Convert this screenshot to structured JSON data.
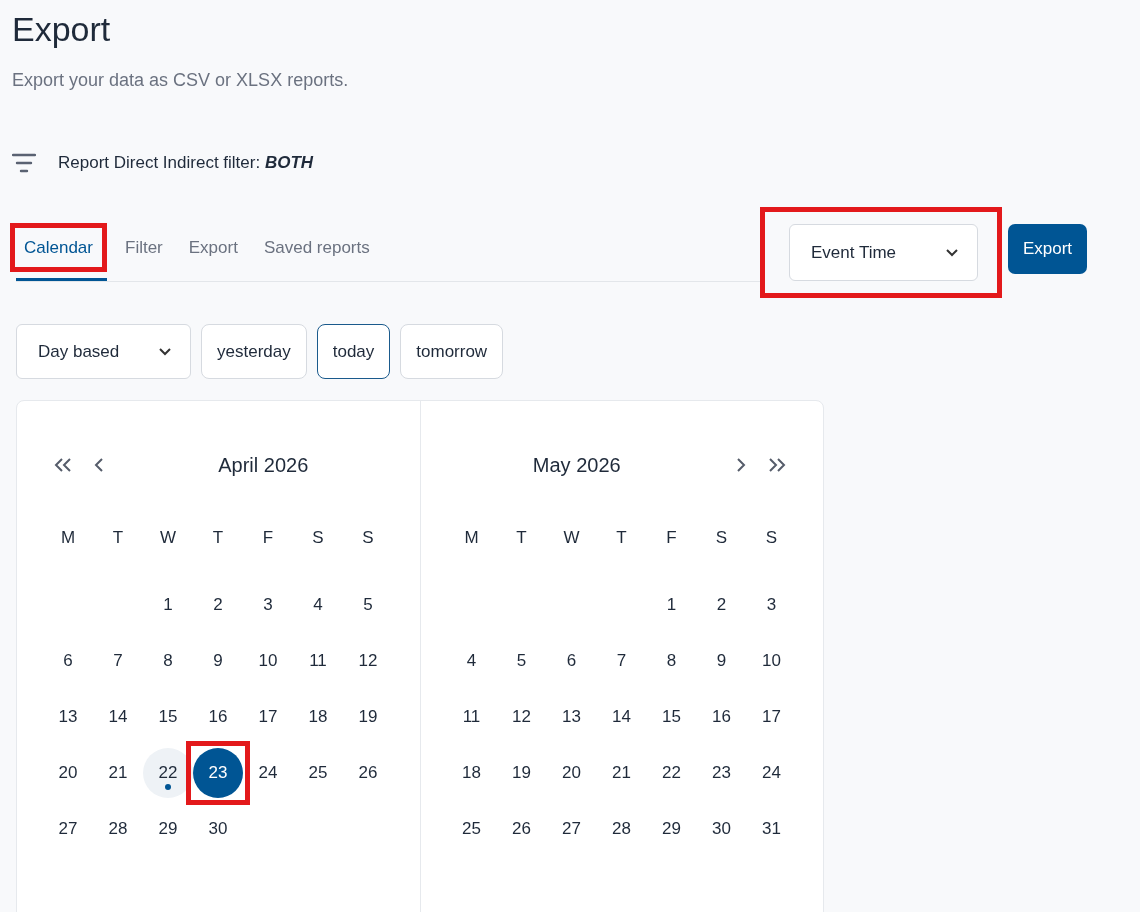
{
  "page": {
    "title": "Export",
    "subtitle": "Export your data as CSV or XLSX reports."
  },
  "filter_summary": {
    "label": "Report Direct Indirect filter:",
    "value": "BOTH"
  },
  "tabs": [
    {
      "label": "Calendar",
      "selected": true,
      "annotated": true
    },
    {
      "label": "Filter",
      "selected": false,
      "annotated": false
    },
    {
      "label": "Export",
      "selected": false,
      "annotated": false
    },
    {
      "label": "Saved reports",
      "selected": false,
      "annotated": false
    }
  ],
  "time_dropdown": {
    "value": "Event Time",
    "annotated": true
  },
  "export_button": {
    "label": "Export"
  },
  "range_dropdown": {
    "value": "Day based"
  },
  "quick_buttons": [
    {
      "label": "yesterday",
      "selected": false
    },
    {
      "label": "today",
      "selected": true
    },
    {
      "label": "tomorrow",
      "selected": false
    }
  ],
  "calendar": {
    "months": [
      {
        "title": "April 2026",
        "prev_buttons": true,
        "next_buttons": false,
        "weekdays": [
          "M",
          "T",
          "W",
          "T",
          "F",
          "S",
          "S"
        ],
        "days": [
          {
            "kind": "blank"
          },
          {
            "kind": "blank"
          },
          {
            "kind": "day",
            "label": "1",
            "selected": false,
            "today": false,
            "annotated": false
          },
          {
            "kind": "day",
            "label": "2",
            "selected": false,
            "today": false,
            "annotated": false
          },
          {
            "kind": "day",
            "label": "3",
            "selected": false,
            "today": false,
            "annotated": false
          },
          {
            "kind": "day",
            "label": "4",
            "selected": false,
            "today": false,
            "annotated": false
          },
          {
            "kind": "day",
            "label": "5",
            "selected": false,
            "today": false,
            "annotated": false
          },
          {
            "kind": "day",
            "label": "6",
            "selected": false,
            "today": false,
            "annotated": false
          },
          {
            "kind": "day",
            "label": "7",
            "selected": false,
            "today": false,
            "annotated": false
          },
          {
            "kind": "day",
            "label": "8",
            "selected": false,
            "today": false,
            "annotated": false
          },
          {
            "kind": "day",
            "label": "9",
            "selected": false,
            "today": false,
            "annotated": false
          },
          {
            "kind": "day",
            "label": "10",
            "selected": false,
            "today": false,
            "annotated": false
          },
          {
            "kind": "day",
            "label": "11",
            "selected": false,
            "today": false,
            "annotated": false
          },
          {
            "kind": "day",
            "label": "12",
            "selected": false,
            "today": false,
            "annotated": false
          },
          {
            "kind": "day",
            "label": "13",
            "selected": false,
            "today": false,
            "annotated": false
          },
          {
            "kind": "day",
            "label": "14",
            "selected": false,
            "today": false,
            "annotated": false
          },
          {
            "kind": "day",
            "label": "15",
            "selected": false,
            "today": false,
            "annotated": false
          },
          {
            "kind": "day",
            "label": "16",
            "selected": false,
            "today": false,
            "annotated": false
          },
          {
            "kind": "day",
            "label": "17",
            "selected": false,
            "today": false,
            "annotated": false
          },
          {
            "kind": "day",
            "label": "18",
            "selected": false,
            "today": false,
            "annotated": false
          },
          {
            "kind": "day",
            "label": "19",
            "selected": false,
            "today": false,
            "annotated": false
          },
          {
            "kind": "day",
            "label": "20",
            "selected": false,
            "today": false,
            "annotated": false
          },
          {
            "kind": "day",
            "label": "21",
            "selected": false,
            "today": false,
            "annotated": false
          },
          {
            "kind": "day",
            "label": "22",
            "selected": false,
            "today": true,
            "annotated": false
          },
          {
            "kind": "day",
            "label": "23",
            "selected": true,
            "today": false,
            "annotated": true
          },
          {
            "kind": "day",
            "label": "24",
            "selected": false,
            "today": false,
            "annotated": false
          },
          {
            "kind": "day",
            "label": "25",
            "selected": false,
            "today": false,
            "annotated": false
          },
          {
            "kind": "day",
            "label": "26",
            "selected": false,
            "today": false,
            "annotated": false
          },
          {
            "kind": "day",
            "label": "27",
            "selected": false,
            "today": false,
            "annotated": false
          },
          {
            "kind": "day",
            "label": "28",
            "selected": false,
            "today": false,
            "annotated": false
          },
          {
            "kind": "day",
            "label": "29",
            "selected": false,
            "today": false,
            "annotated": false
          },
          {
            "kind": "day",
            "label": "30",
            "selected": false,
            "today": false,
            "annotated": false
          }
        ]
      },
      {
        "title": "May 2026",
        "prev_buttons": false,
        "next_buttons": true,
        "weekdays": [
          "M",
          "T",
          "W",
          "T",
          "F",
          "S",
          "S"
        ],
        "days": [
          {
            "kind": "blank"
          },
          {
            "kind": "blank"
          },
          {
            "kind": "blank"
          },
          {
            "kind": "blank"
          },
          {
            "kind": "day",
            "label": "1",
            "selected": false,
            "today": false,
            "annotated": false
          },
          {
            "kind": "day",
            "label": "2",
            "selected": false,
            "today": false,
            "annotated": false
          },
          {
            "kind": "day",
            "label": "3",
            "selected": false,
            "today": false,
            "annotated": false
          },
          {
            "kind": "day",
            "label": "4",
            "selected": false,
            "today": false,
            "annotated": false
          },
          {
            "kind": "day",
            "label": "5",
            "selected": false,
            "today": false,
            "annotated": false
          },
          {
            "kind": "day",
            "label": "6",
            "selected": false,
            "today": false,
            "annotated": false
          },
          {
            "kind": "day",
            "label": "7",
            "selected": false,
            "today": false,
            "annotated": false
          },
          {
            "kind": "day",
            "label": "8",
            "selected": false,
            "today": false,
            "annotated": false
          },
          {
            "kind": "day",
            "label": "9",
            "selected": false,
            "today": false,
            "annotated": false
          },
          {
            "kind": "day",
            "label": "10",
            "selected": false,
            "today": false,
            "annotated": false
          },
          {
            "kind": "day",
            "label": "11",
            "selected": false,
            "today": false,
            "annotated": false
          },
          {
            "kind": "day",
            "label": "12",
            "selected": false,
            "today": false,
            "annotated": false
          },
          {
            "kind": "day",
            "label": "13",
            "selected": false,
            "today": false,
            "annotated": false
          },
          {
            "kind": "day",
            "label": "14",
            "selected": false,
            "today": false,
            "annotated": false
          },
          {
            "kind": "day",
            "label": "15",
            "selected": false,
            "today": false,
            "annotated": false
          },
          {
            "kind": "day",
            "label": "16",
            "selected": false,
            "today": false,
            "annotated": false
          },
          {
            "kind": "day",
            "label": "17",
            "selected": false,
            "today": false,
            "annotated": false
          },
          {
            "kind": "day",
            "label": "18",
            "selected": false,
            "today": false,
            "annotated": false
          },
          {
            "kind": "day",
            "label": "19",
            "selected": false,
            "today": false,
            "annotated": false
          },
          {
            "kind": "day",
            "label": "20",
            "selected": false,
            "today": false,
            "annotated": false
          },
          {
            "kind": "day",
            "label": "21",
            "selected": false,
            "today": false,
            "annotated": false
          },
          {
            "kind": "day",
            "label": "22",
            "selected": false,
            "today": false,
            "annotated": false
          },
          {
            "kind": "day",
            "label": "23",
            "selected": false,
            "today": false,
            "annotated": false
          },
          {
            "kind": "day",
            "label": "24",
            "selected": false,
            "today": false,
            "annotated": false
          },
          {
            "kind": "day",
            "label": "25",
            "selected": false,
            "today": false,
            "annotated": false
          },
          {
            "kind": "day",
            "label": "26",
            "selected": false,
            "today": false,
            "annotated": false
          },
          {
            "kind": "day",
            "label": "27",
            "selected": false,
            "today": false,
            "annotated": false
          },
          {
            "kind": "day",
            "label": "28",
            "selected": false,
            "today": false,
            "annotated": false
          },
          {
            "kind": "day",
            "label": "29",
            "selected": false,
            "today": false,
            "annotated": false
          },
          {
            "kind": "day",
            "label": "30",
            "selected": false,
            "today": false,
            "annotated": false
          },
          {
            "kind": "day",
            "label": "31",
            "selected": false,
            "today": false,
            "annotated": false
          }
        ]
      }
    ]
  }
}
